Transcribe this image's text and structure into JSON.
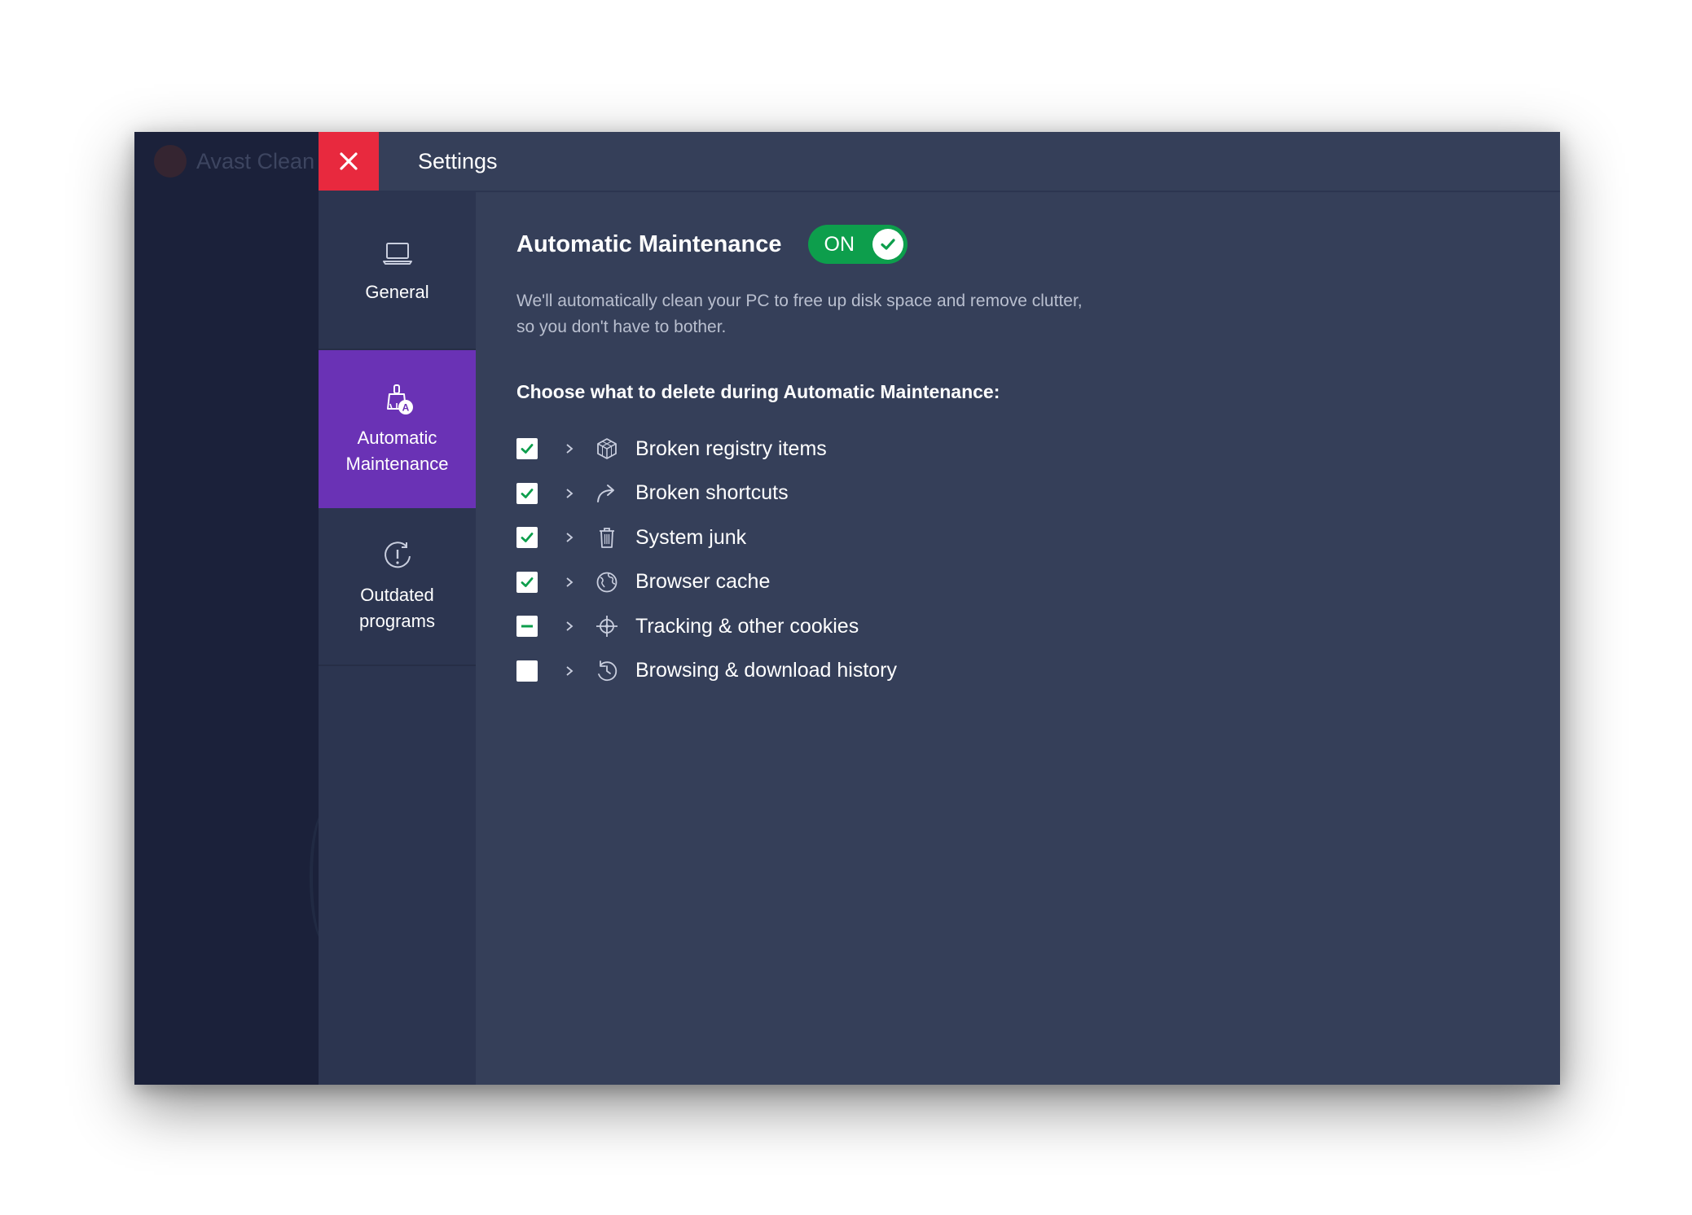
{
  "background_app": {
    "title": "Avast Clean"
  },
  "topbar": {
    "close_icon": "close-icon",
    "title": "Settings"
  },
  "nav": {
    "items": [
      {
        "label": "General",
        "icon": "laptop-icon",
        "active": false
      },
      {
        "label": "Automatic\nMaintenance",
        "icon": "broom-auto-icon",
        "active": true
      },
      {
        "label": "Outdated\nprograms",
        "icon": "outdated-clock-icon",
        "active": false
      }
    ]
  },
  "main": {
    "heading": "Automatic Maintenance",
    "toggle": {
      "label": "ON",
      "state": "on"
    },
    "description": "We'll automatically clean your PC to free up disk space and remove clutter, so you don't have to bother.",
    "choose_label": "Choose what to delete during Automatic Maintenance:",
    "items": [
      {
        "label": "Broken registry items",
        "icon": "registry-cube-icon",
        "state": "checked"
      },
      {
        "label": "Broken shortcuts",
        "icon": "shortcut-arrow-icon",
        "state": "checked"
      },
      {
        "label": "System junk",
        "icon": "trash-icon",
        "state": "checked"
      },
      {
        "label": "Browser cache",
        "icon": "globe-icon",
        "state": "checked"
      },
      {
        "label": "Tracking & other cookies",
        "icon": "crosshair-icon",
        "state": "partial"
      },
      {
        "label": "Browsing & download history",
        "icon": "history-icon",
        "state": "unchecked"
      }
    ]
  },
  "colors": {
    "close_red": "#e8293e",
    "active_purple": "#6a32b5",
    "toggle_green": "#0d9e4c",
    "check_green": "#0d9e4c",
    "panel_bg": "#353f59",
    "nav_bg": "#2c3550"
  }
}
